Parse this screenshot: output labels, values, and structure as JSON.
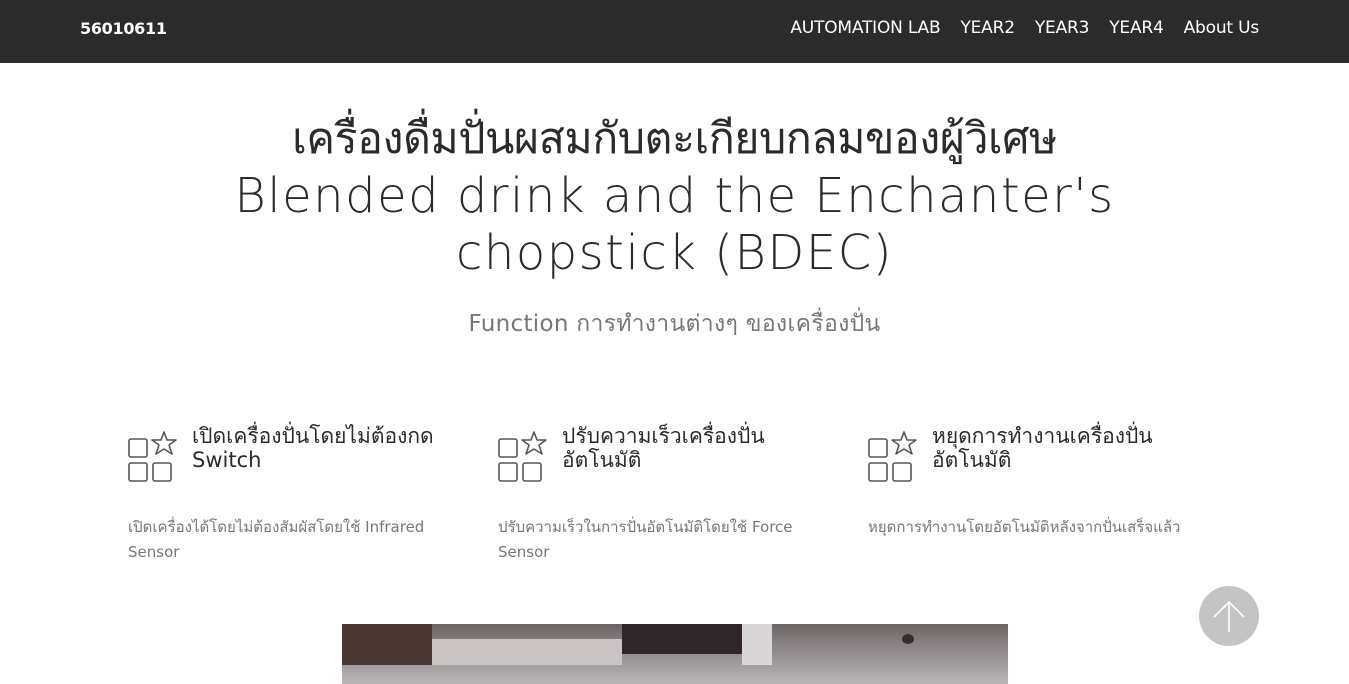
{
  "navbar": {
    "brand": "56010611",
    "links": [
      "AUTOMATION LAB",
      "YEAR2",
      "YEAR3",
      "YEAR4",
      "About Us"
    ],
    "background_color": "#2b2b2b"
  },
  "hero": {
    "title_thai": "เครื่องดื่มปั่นผสมกับตะเกียบกลมของผู้วิเศษ",
    "title_en": "Blended drink and the Enchanter's chopstick (BDEC)",
    "subtitle": "Function การทำงานต่างๆ ของเครื่องปั่น"
  },
  "features": [
    {
      "icon": "grid-star-icon",
      "title": "เปิดเครื่องปั่นโดยไม่ต้องกด Switch",
      "description": "เปิดเครื่องได้โดยไม่ต้องสัมผัสโดยใช้ Infrared Sensor"
    },
    {
      "icon": "grid-star-icon",
      "title": "ปรับความเร็วเครื่องปั่นอัตโนมัติ",
      "description": "ปรับความเร็วในการปั่นอัตโนมัติโดยใช้ Force Sensor"
    },
    {
      "icon": "grid-star-icon",
      "title": "หยุดการทำงานเครื่องปั่นอัตโนมัติ",
      "description": "หยุดการทำงานโดยอัตโนมัติหลังจากปั่นเสร็จแล้ว"
    }
  ],
  "back_to_top": {
    "icon": "arrow-up-icon"
  }
}
